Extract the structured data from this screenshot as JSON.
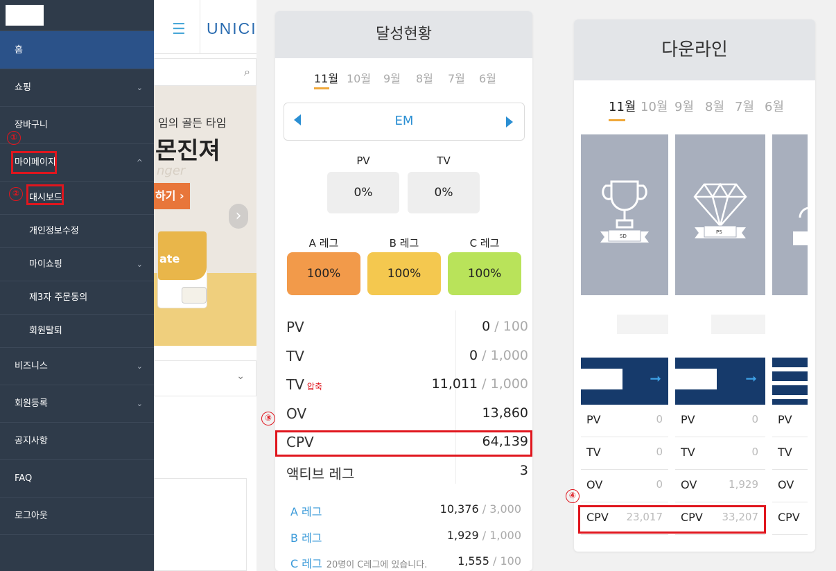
{
  "bg_app": {
    "logo": "UNICIT",
    "banner_line1": "임의 골든 타임",
    "banner_line2": "몬진져",
    "banner_line3": "nger",
    "banner_button": "하기 ›",
    "product_label": "ate"
  },
  "sidebar": {
    "items": [
      {
        "label": "홈",
        "chev": ""
      },
      {
        "label": "쇼핑",
        "chev": "⌄"
      },
      {
        "label": "장바구니",
        "chev": ""
      },
      {
        "label": "마이페이지",
        "chev": "^"
      },
      {
        "label": "대시보드",
        "chev": ""
      },
      {
        "label": "개인정보수정",
        "chev": ""
      },
      {
        "label": "마이쇼핑",
        "chev": "⌄"
      },
      {
        "label": "제3자 주문동의",
        "chev": ""
      },
      {
        "label": "회원탈퇴",
        "chev": ""
      },
      {
        "label": "비즈니스",
        "chev": "⌄"
      },
      {
        "label": "회원등록",
        "chev": "⌄"
      },
      {
        "label": "공지사항",
        "chev": ""
      },
      {
        "label": "FAQ",
        "chev": ""
      },
      {
        "label": "로그아웃",
        "chev": ""
      }
    ]
  },
  "annotations": {
    "n1": "①",
    "n2": "②",
    "n3": "③",
    "n4": "④"
  },
  "achievement": {
    "title": "달성현황",
    "months": [
      "11월",
      "10월",
      "9월",
      "8월",
      "7월",
      "6월"
    ],
    "rank": "EM",
    "pv_label": "PV",
    "tv_label": "TV",
    "pv_value": "0%",
    "tv_value": "0%",
    "legs": [
      {
        "label": "A 레그",
        "value": "100%",
        "color": "#f29a4a"
      },
      {
        "label": "B 레그",
        "value": "100%",
        "color": "#f4c84f"
      },
      {
        "label": "C 레그",
        "value": "100%",
        "color": "#b9e35a"
      }
    ],
    "rows": [
      {
        "key": "PV",
        "tag": "",
        "value": "0",
        "max": " / 100"
      },
      {
        "key": "TV",
        "tag": "",
        "value": "0",
        "max": " / 1,000"
      },
      {
        "key": "TV",
        "tag": "압축",
        "value": "11,011",
        "max": " / 1,000"
      },
      {
        "key": "OV",
        "tag": "",
        "value": "13,860",
        "max": ""
      },
      {
        "key": "CPV",
        "tag": "",
        "value": "64,139",
        "max": ""
      },
      {
        "key": "액티브 레그",
        "tag": "",
        "value": "3",
        "max": ""
      }
    ],
    "leg_rows": [
      {
        "key": "A 레그",
        "note": "",
        "value": "10,376",
        "max": " / 3,000"
      },
      {
        "key": "B 레그",
        "note": "",
        "value": "1,929",
        "max": " / 1,000"
      },
      {
        "key": "C 레그",
        "note": "20명이 C레그에 있습니다.",
        "value": "1,555",
        "max": " / 100"
      }
    ]
  },
  "downline": {
    "title": "다운라인",
    "months": [
      "11월",
      "10월",
      "9월",
      "8월",
      "7월",
      "6월"
    ],
    "cols": [
      {
        "badge": "SD",
        "icon": "trophy-icon",
        "pv": "0",
        "tv": "0",
        "ov": "0",
        "cpv": "23,017"
      },
      {
        "badge": "PS",
        "icon": "diamond-icon",
        "pv": "0",
        "tv": "0",
        "ov": "1,929",
        "cpv": "33,207"
      },
      {
        "badge": "",
        "icon": "lock-icon",
        "pv": "",
        "tv": "",
        "ov": "",
        "cpv": ""
      }
    ],
    "row_labels": [
      "PV",
      "TV",
      "OV",
      "CPV"
    ]
  }
}
